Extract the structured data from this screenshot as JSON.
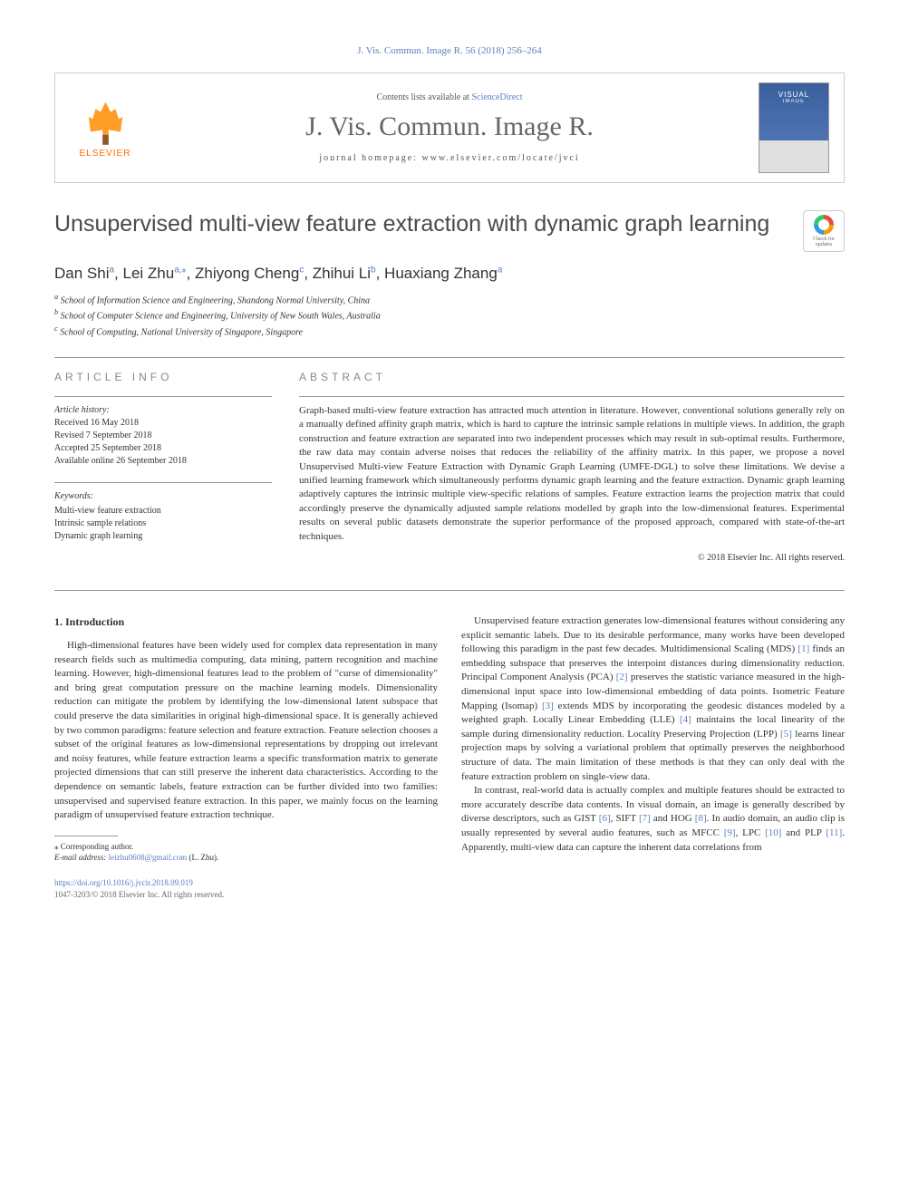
{
  "header_cite": "J. Vis. Commun. Image R. 56 (2018) 256–264",
  "banner": {
    "contents_text": "Contents lists available at ",
    "contents_link": "ScienceDirect",
    "journal_name": "J. Vis. Commun. Image R.",
    "homepage_label": "journal homepage: ",
    "homepage_url": "www.elsevier.com/locate/jvci",
    "elsevier_label": "ELSEVIER",
    "cover_text": "VISUAL",
    "cover_sub": "IMAGE"
  },
  "title": "Unsupervised multi-view feature extraction with dynamic graph learning",
  "check_badge": {
    "line1": "Check for",
    "line2": "updates"
  },
  "authors": {
    "a1": {
      "name": "Dan Shi",
      "sup": "a"
    },
    "a2": {
      "name": "Lei Zhu",
      "sup": "a,⁎"
    },
    "a3": {
      "name": "Zhiyong Cheng",
      "sup": "c"
    },
    "a4": {
      "name": "Zhihui Li",
      "sup": "b"
    },
    "a5": {
      "name": "Huaxiang Zhang",
      "sup": "a"
    }
  },
  "affiliations": {
    "a": "School of Information Science and Engineering, Shandong Normal University, China",
    "b": "School of Computer Science and Engineering, University of New South Wales, Australia",
    "c": "School of Computing, National University of Singapore, Singapore"
  },
  "article_info": {
    "heading": "ARTICLE INFO",
    "history_label": "Article history:",
    "received": "Received 16 May 2018",
    "revised": "Revised 7 September 2018",
    "accepted": "Accepted 25 September 2018",
    "online": "Available online 26 September 2018",
    "keywords_label": "Keywords:",
    "kw1": "Multi-view feature extraction",
    "kw2": "Intrinsic sample relations",
    "kw3": "Dynamic graph learning"
  },
  "abstract": {
    "heading": "ABSTRACT",
    "text": "Graph-based multi-view feature extraction has attracted much attention in literature. However, conventional solutions generally rely on a manually defined affinity graph matrix, which is hard to capture the intrinsic sample relations in multiple views. In addition, the graph construction and feature extraction are separated into two independent processes which may result in sub-optimal results. Furthermore, the raw data may contain adverse noises that reduces the reliability of the affinity matrix. In this paper, we propose a novel Unsupervised Multi-view Feature Extraction with Dynamic Graph Learning (UMFE-DGL) to solve these limitations. We devise a unified learning framework which simultaneously performs dynamic graph learning and the feature extraction. Dynamic graph learning adaptively captures the intrinsic multiple view-specific relations of samples. Feature extraction learns the projection matrix that could accordingly preserve the dynamically adjusted sample relations modelled by graph into the low-dimensional features. Experimental results on several public datasets demonstrate the superior performance of the proposed approach, compared with state-of-the-art techniques.",
    "copyright": "© 2018 Elsevier Inc. All rights reserved."
  },
  "section1": {
    "heading": "1. Introduction",
    "p1": "High-dimensional features have been widely used for complex data representation in many research fields such as multimedia computing, data mining, pattern recognition and machine learning. However, high-dimensional features lead to the problem of \"curse of dimensionality\" and bring great computation pressure on the machine learning models. Dimensionality reduction can mitigate the problem by identifying the low-dimensional latent subspace that could preserve the data similarities in original high-dimensional space. It is generally achieved by two common paradigms: feature selection and feature extraction. Feature selection chooses a subset of the original features as low-dimensional representations by dropping out irrelevant and noisy features, while feature extraction learns a specific transformation matrix to generate projected dimensions that can still preserve the inherent data characteristics. According to the dependence on semantic labels, feature extraction can be further divided into two families: unsupervised and supervised feature extraction. In this paper, we mainly focus on the learning paradigm of unsupervised feature extraction technique.",
    "p2a": "Unsupervised feature extraction generates low-dimensional features without considering any explicit semantic labels. Due to its desirable performance, many works have been developed following this paradigm in the past few decades. Multidimensional Scaling (MDS) ",
    "r1": "[1]",
    "p2b": " finds an embedding subspace that preserves the interpoint distances during dimensionality reduction. Principal Component Analysis (PCA) ",
    "r2": "[2]",
    "p2c": " preserves the statistic variance measured in the high-dimensional input space into low-dimensional embedding of data points. Isometric Feature Mapping (Isomap) ",
    "r3": "[3]",
    "p2d": " extends MDS by incorporating the geodesic distances modeled by a weighted graph. Locally Linear Embedding (LLE) ",
    "r4": "[4]",
    "p2e": " maintains the local linearity of the sample during dimensionality reduction. Locality Preserving Projection (LPP) ",
    "r5": "[5]",
    "p2f": " learns linear projection maps by solving a variational problem that optimally preserves the neighborhood structure of data. The main limitation of these methods is that they can only deal with the feature extraction problem on single-view data.",
    "p3a": "In contrast, real-world data is actually complex and multiple features should be extracted to more accurately describe data contents. In visual domain, an image is generally described by diverse descriptors, such as GIST ",
    "r6": "[6]",
    "p3b": ", SIFT ",
    "r7": "[7]",
    "p3c": " and HOG ",
    "r8": "[8]",
    "p3d": ". In audio domain, an audio clip is usually represented by several audio features, such as MFCC ",
    "r9": "[9]",
    "p3e": ", LPC ",
    "r10": "[10]",
    "p3f": " and PLP ",
    "r11": "[11]",
    "p3g": ". Apparently, multi-view data can capture the inherent data correlations from"
  },
  "footnote": {
    "corr_label": "⁎ Corresponding author.",
    "email_label": "E-mail address: ",
    "email": "leizhu0608@gmail.com",
    "email_author": " (L. Zhu)."
  },
  "footer": {
    "doi": "https://doi.org/10.1016/j.jvcir.2018.09.019",
    "copyright": "1047-3203/© 2018 Elsevier Inc. All rights reserved."
  }
}
